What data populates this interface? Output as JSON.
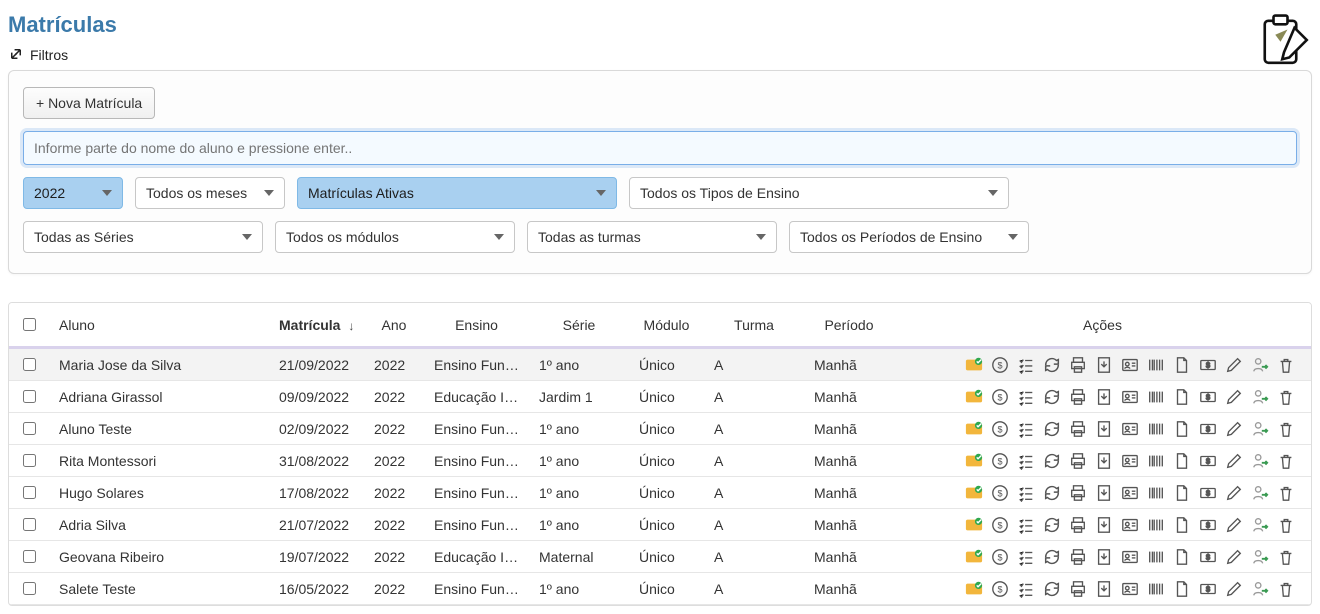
{
  "page": {
    "title": "Matrículas"
  },
  "filters": {
    "label": "Filtros",
    "new_button": "+ Nova Matrícula",
    "search_placeholder": "Informe parte do nome do aluno e pressione enter..",
    "year": "2022",
    "month": "Todos os meses",
    "status": "Matrículas Ativas",
    "tipo_ensino": "Todos os Tipos de Ensino",
    "serie": "Todas as Séries",
    "modulo": "Todos os módulos",
    "turma": "Todas as turmas",
    "periodo": "Todos os Períodos de Ensino"
  },
  "table": {
    "headers": {
      "aluno": "Aluno",
      "matricula": "Matrícula",
      "ano": "Ano",
      "ensino": "Ensino",
      "serie": "Série",
      "modulo": "Módulo",
      "turma": "Turma",
      "periodo": "Período",
      "acoes": "Ações"
    },
    "rows": [
      {
        "aluno": "Maria Jose da Silva",
        "matricula": "21/09/2022",
        "ano": "2022",
        "ensino": "Ensino Fund…",
        "serie": "1º ano",
        "modulo": "Único",
        "turma": "A",
        "periodo": "Manhã"
      },
      {
        "aluno": "Adriana Girassol",
        "matricula": "09/09/2022",
        "ano": "2022",
        "ensino": "Educação Inf…",
        "serie": "Jardim 1",
        "modulo": "Único",
        "turma": "A",
        "periodo": "Manhã"
      },
      {
        "aluno": "Aluno Teste",
        "matricula": "02/09/2022",
        "ano": "2022",
        "ensino": "Ensino Fund…",
        "serie": "1º ano",
        "modulo": "Único",
        "turma": "A",
        "periodo": "Manhã"
      },
      {
        "aluno": "Rita Montessori",
        "matricula": "31/08/2022",
        "ano": "2022",
        "ensino": "Ensino Fund…",
        "serie": "1º ano",
        "modulo": "Único",
        "turma": "A",
        "periodo": "Manhã"
      },
      {
        "aluno": "Hugo Solares",
        "matricula": "17/08/2022",
        "ano": "2022",
        "ensino": "Ensino Fund…",
        "serie": "1º ano",
        "modulo": "Único",
        "turma": "A",
        "periodo": "Manhã"
      },
      {
        "aluno": "Adria Silva",
        "matricula": "21/07/2022",
        "ano": "2022",
        "ensino": "Ensino Fund…",
        "serie": "1º ano",
        "modulo": "Único",
        "turma": "A",
        "periodo": "Manhã"
      },
      {
        "aluno": "Geovana Ribeiro",
        "matricula": "19/07/2022",
        "ano": "2022",
        "ensino": "Educação Inf…",
        "serie": "Maternal",
        "modulo": "Único",
        "turma": "A",
        "periodo": "Manhã"
      },
      {
        "aluno": "Salete Teste",
        "matricula": "16/05/2022",
        "ano": "2022",
        "ensino": "Ensino Fund…",
        "serie": "1º ano",
        "modulo": "Único",
        "turma": "A",
        "periodo": "Manhã"
      }
    ]
  },
  "action_icons": [
    {
      "name": "id-card-icon",
      "color": "#f2b63c",
      "accent": "#2fa84f"
    },
    {
      "name": "money-icon",
      "color": "#555"
    },
    {
      "name": "checklist-icon",
      "color": "#555"
    },
    {
      "name": "refresh-icon",
      "color": "#555"
    },
    {
      "name": "print-icon",
      "color": "#555"
    },
    {
      "name": "doc-down-icon",
      "color": "#555"
    },
    {
      "name": "profile-card-icon",
      "color": "#555"
    },
    {
      "name": "barcode-icon",
      "color": "#555"
    },
    {
      "name": "blank-doc-icon",
      "color": "#555"
    },
    {
      "name": "money-doc-icon",
      "color": "#555"
    },
    {
      "name": "pencil-icon",
      "color": "#555"
    },
    {
      "name": "user-move-icon",
      "color": "#3a9a52"
    },
    {
      "name": "trash-icon",
      "color": "#555"
    }
  ]
}
